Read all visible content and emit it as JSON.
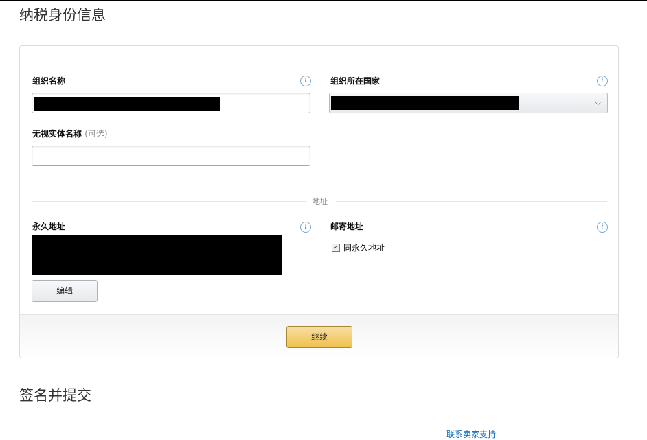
{
  "page": {
    "title": "纳税身份信息",
    "next_section_title": "签名并提交",
    "support_link": "联系卖家支持"
  },
  "form": {
    "org_name_label": "组织名称",
    "org_country_label": "组织所在国家",
    "disregarded_entity_label": "无视实体名称",
    "optional_tag": "(可选)",
    "address_divider": "地址",
    "permanent_address_label": "永久地址",
    "mailing_address_label": "邮寄地址",
    "same_as_permanent_label": "同永久地址",
    "same_as_permanent_checked": true,
    "edit_button": "编辑",
    "continue_button": "继续",
    "info_icon": "i"
  },
  "icons": {
    "info": "info-icon",
    "chevron": "chevron-down-icon",
    "check": "checkbox-check-icon"
  },
  "colors": {
    "primary_button": "#f0c14b",
    "link": "#0066c0",
    "info_icon": "#4f86c6"
  }
}
